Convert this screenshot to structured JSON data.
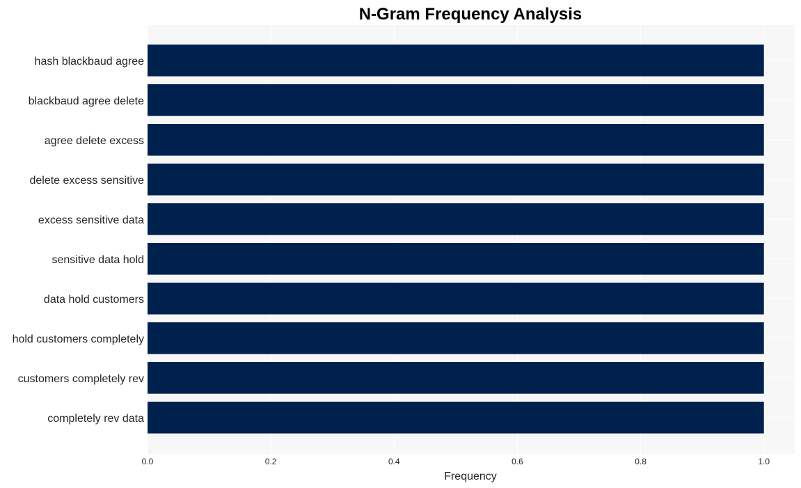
{
  "chart_data": {
    "type": "bar",
    "orientation": "horizontal",
    "title": "N-Gram Frequency Analysis",
    "xlabel": "Frequency",
    "ylabel": "",
    "categories": [
      "hash blackbaud agree",
      "blackbaud agree delete",
      "agree delete excess",
      "delete excess sensitive",
      "excess sensitive data",
      "sensitive data hold",
      "data hold customers",
      "hold customers completely",
      "customers completely rev",
      "completely rev data"
    ],
    "values": [
      1,
      1,
      1,
      1,
      1,
      1,
      1,
      1,
      1,
      1
    ],
    "xlim": [
      0,
      1.05
    ],
    "xticks": [
      0.0,
      0.2,
      0.4,
      0.6,
      0.8,
      1.0
    ],
    "xtick_labels": [
      "0.0",
      "0.2",
      "0.4",
      "0.6",
      "0.8",
      "1.0"
    ],
    "grid": true,
    "legend": "none",
    "colors": {
      "bar": "#00214e",
      "plot_background": "#f7f7f7",
      "grid": "#ffffff",
      "text": "#262626"
    }
  }
}
